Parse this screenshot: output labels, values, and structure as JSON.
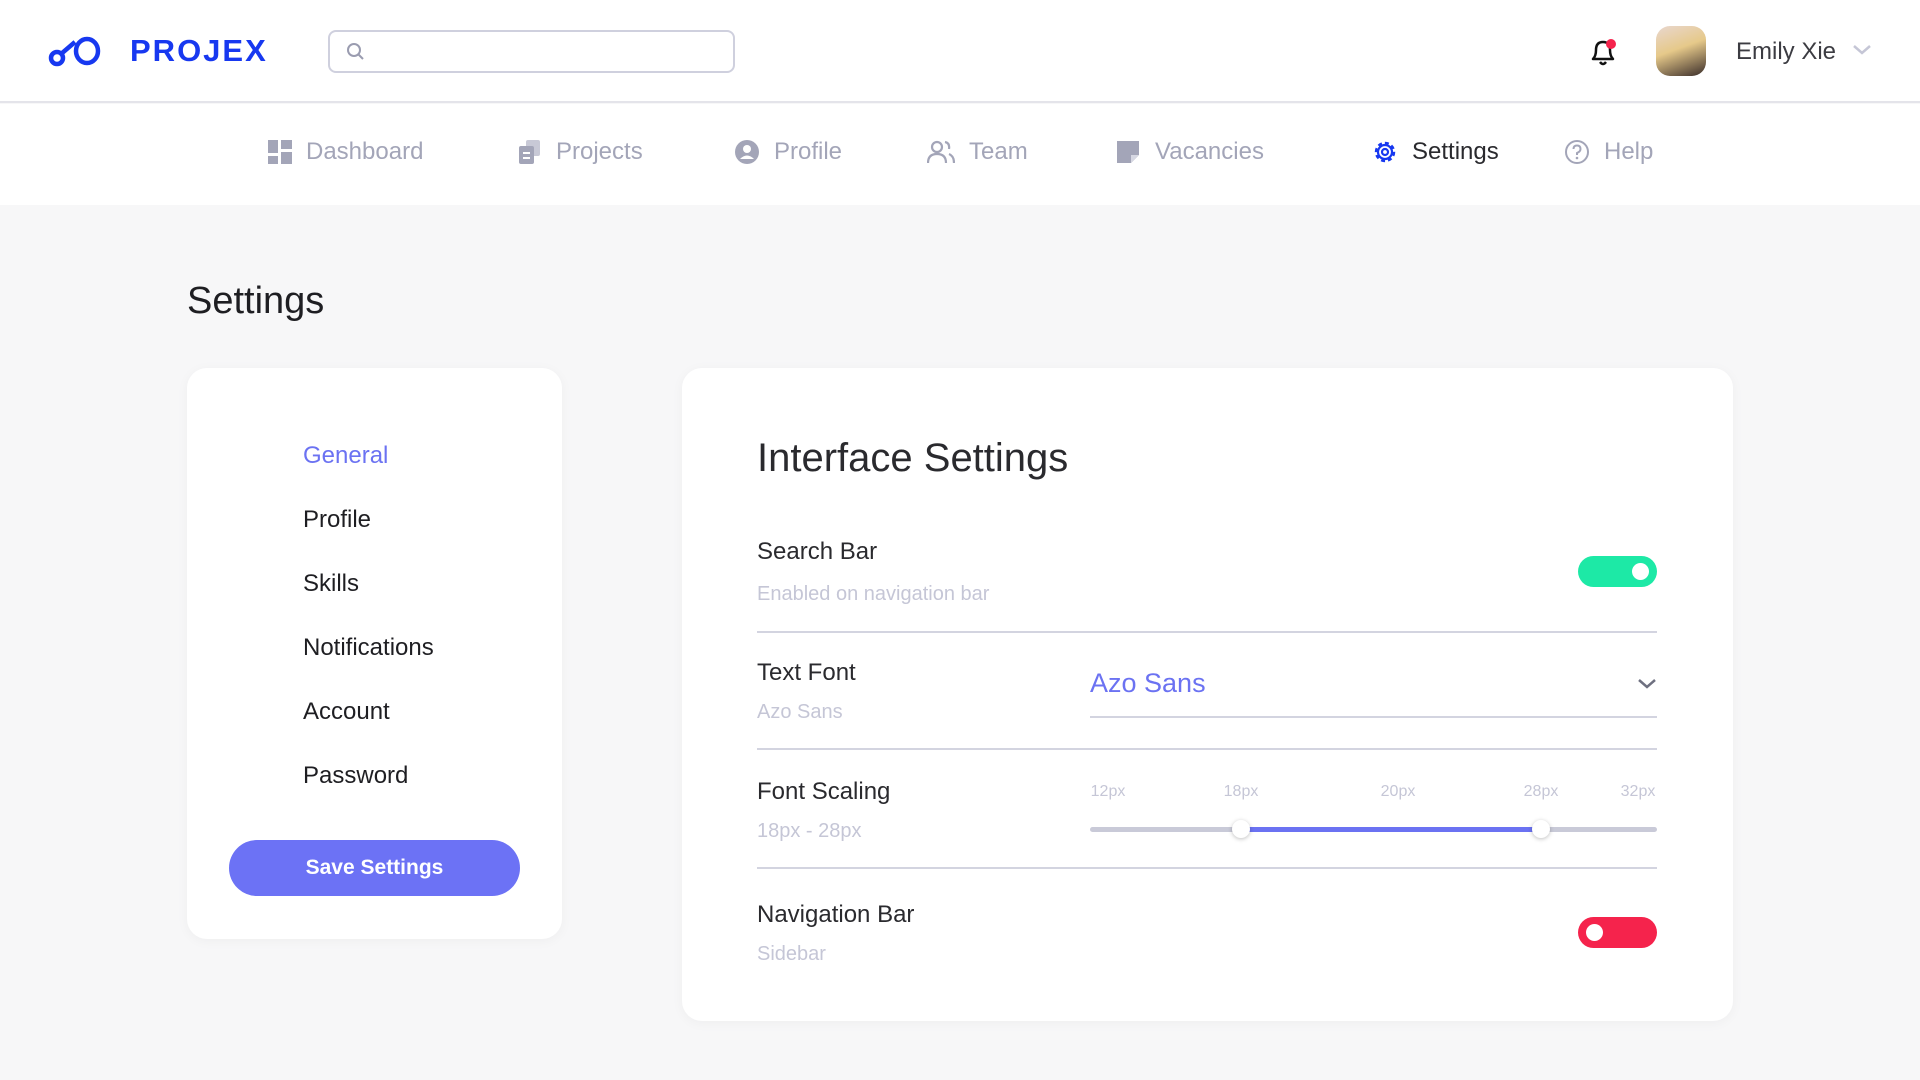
{
  "header": {
    "brand": "PROJEX",
    "search": {
      "placeholder": "",
      "value": ""
    },
    "user_name": "Emily Xie",
    "notification_dot": true
  },
  "nav": {
    "items": [
      {
        "label": "Dashboard",
        "icon": "dashboard-icon"
      },
      {
        "label": "Projects",
        "icon": "projects-icon"
      },
      {
        "label": "Profile",
        "icon": "profile-icon"
      },
      {
        "label": "Team",
        "icon": "team-icon"
      },
      {
        "label": "Vacancies",
        "icon": "vacancies-icon"
      },
      {
        "label": "Settings",
        "icon": "gear-icon",
        "active": true
      },
      {
        "label": "Help",
        "icon": "help-icon"
      }
    ]
  },
  "page_title": "Settings",
  "sidebar": {
    "items": [
      {
        "label": "General",
        "active": true
      },
      {
        "label": "Profile"
      },
      {
        "label": "Skills"
      },
      {
        "label": "Notifications"
      },
      {
        "label": "Account"
      },
      {
        "label": "Password"
      }
    ],
    "save_label": "Save Settings"
  },
  "interface": {
    "title": "Interface Settings",
    "search_bar": {
      "label": "Search Bar",
      "sub": "Enabled on navigation bar",
      "on": true
    },
    "text_font": {
      "label": "Text Font",
      "sub": "Azo Sans",
      "value": "Azo Sans"
    },
    "font_scaling": {
      "label": "Font Scaling",
      "sub": "18px - 28px",
      "ticks": [
        "12px",
        "18px",
        "20px",
        "28px",
        "32px"
      ],
      "range": [
        "18px",
        "28px"
      ]
    },
    "navigation_bar": {
      "label": "Navigation Bar",
      "sub": "Sidebar",
      "on": false
    }
  },
  "colors": {
    "brand": "#1738f0",
    "accent": "#6b72f2",
    "toggle_on": "#1de9a6",
    "toggle_off": "#f5234c"
  }
}
